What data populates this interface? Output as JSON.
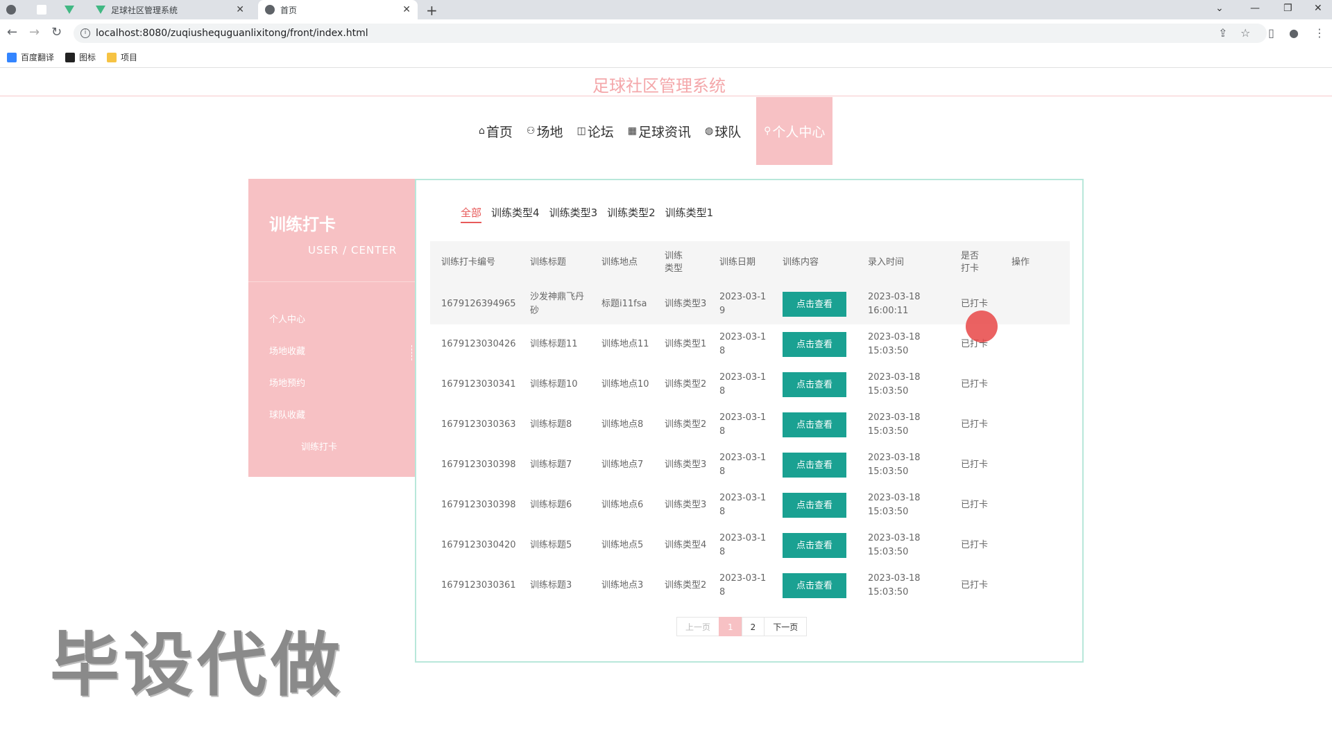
{
  "browser": {
    "tabs": [
      {
        "title": "足球社区管理系统"
      },
      {
        "title": "首页"
      }
    ],
    "url": "localhost:8080/zuqiushequguanlixitong/front/index.html",
    "bookmarks": [
      "百度翻译",
      "图标",
      "项目"
    ]
  },
  "site": {
    "title": "足球社区管理系统",
    "nav": [
      {
        "icon": "⌂",
        "label": "首页"
      },
      {
        "icon": "⚇",
        "label": "场地"
      },
      {
        "icon": "◫",
        "label": "论坛"
      },
      {
        "icon": "▦",
        "label": "足球资讯"
      },
      {
        "icon": "◍",
        "label": "球队"
      },
      {
        "icon": "⚲",
        "label": "个人中心"
      }
    ]
  },
  "sidebar": {
    "title": "训练打卡",
    "subtitle": "USER / CENTER",
    "items": [
      "个人中心",
      "场地收藏",
      "场地预约",
      "球队收藏",
      "训练打卡"
    ]
  },
  "filters": [
    "全部",
    "训练类型4",
    "训练类型3",
    "训练类型2",
    "训练类型1"
  ],
  "table": {
    "headers": [
      "训练打卡编号",
      "训练标题",
      "训练地点",
      "训练类型",
      "训练日期",
      "训练内容",
      "录入时间",
      "是否打卡",
      "操作"
    ],
    "button_label": "点击查看",
    "rows": [
      {
        "id": "1679126394965",
        "title": "沙发神鼎飞丹砂",
        "place": "标题i11fsa",
        "type": "训练类型3",
        "date": "2023-03-19",
        "time": "2023-03-18 16:00:11",
        "status": "已打卡"
      },
      {
        "id": "1679123030426",
        "title": "训练标题11",
        "place": "训练地点11",
        "type": "训练类型1",
        "date": "2023-03-18",
        "time": "2023-03-18 15:03:50",
        "status": "已打卡"
      },
      {
        "id": "1679123030341",
        "title": "训练标题10",
        "place": "训练地点10",
        "type": "训练类型2",
        "date": "2023-03-18",
        "time": "2023-03-18 15:03:50",
        "status": "已打卡"
      },
      {
        "id": "1679123030363",
        "title": "训练标题8",
        "place": "训练地点8",
        "type": "训练类型2",
        "date": "2023-03-18",
        "time": "2023-03-18 15:03:50",
        "status": "已打卡"
      },
      {
        "id": "1679123030398",
        "title": "训练标题7",
        "place": "训练地点7",
        "type": "训练类型3",
        "date": "2023-03-18",
        "time": "2023-03-18 15:03:50",
        "status": "已打卡"
      },
      {
        "id": "1679123030398",
        "title": "训练标题6",
        "place": "训练地点6",
        "type": "训练类型3",
        "date": "2023-03-18",
        "time": "2023-03-18 15:03:50",
        "status": "已打卡"
      },
      {
        "id": "1679123030420",
        "title": "训练标题5",
        "place": "训练地点5",
        "type": "训练类型4",
        "date": "2023-03-18",
        "time": "2023-03-18 15:03:50",
        "status": "已打卡"
      },
      {
        "id": "1679123030361",
        "title": "训练标题3",
        "place": "训练地点3",
        "type": "训练类型2",
        "date": "2023-03-18",
        "time": "2023-03-18 15:03:50",
        "status": "已打卡"
      }
    ]
  },
  "pagination": {
    "prev": "上一页",
    "pages": [
      "1",
      "2"
    ],
    "next": "下一页"
  },
  "watermark": "毕设代做",
  "colors": {
    "accent_pink": "#f7c1c4",
    "button_teal": "#1aa192",
    "active_filter": "#e75a5a",
    "panel_border": "#b8e7da"
  }
}
